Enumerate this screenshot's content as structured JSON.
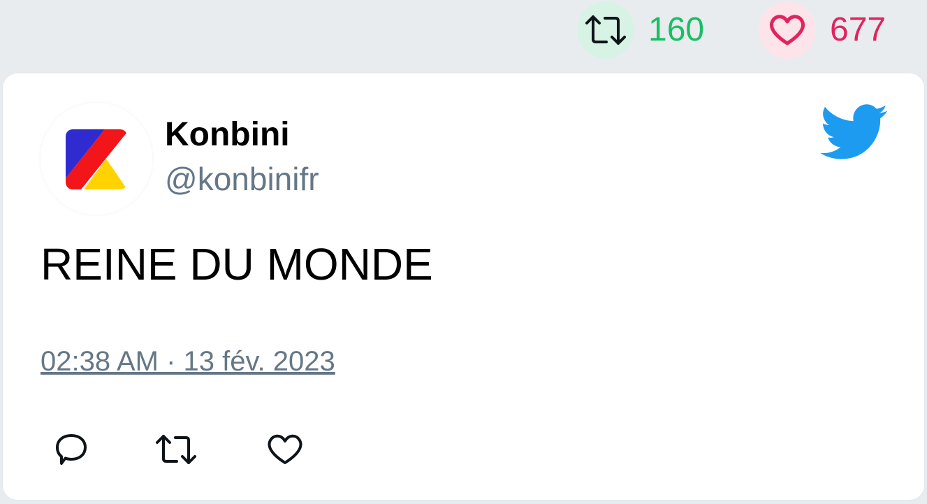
{
  "stats": {
    "retweets": "160",
    "likes": "677",
    "retweet_icon": "retweet-icon",
    "like_icon": "heart-icon"
  },
  "tweet": {
    "display_name": "Konbini",
    "handle": "@konbinifr",
    "text": "REINE DU MONDE",
    "timestamp": "02:38 AM · 13 fév. 2023",
    "brand_icon": "twitter-bird-icon"
  },
  "actions": {
    "reply_icon": "reply-icon",
    "retweet_icon": "retweet-icon",
    "like_icon": "heart-icon"
  },
  "colors": {
    "retweet_green": "#17bf63",
    "like_red": "#e0245e",
    "twitter_blue": "#1d9bf0",
    "muted_gray": "#657786",
    "background": "#e9ecef"
  }
}
